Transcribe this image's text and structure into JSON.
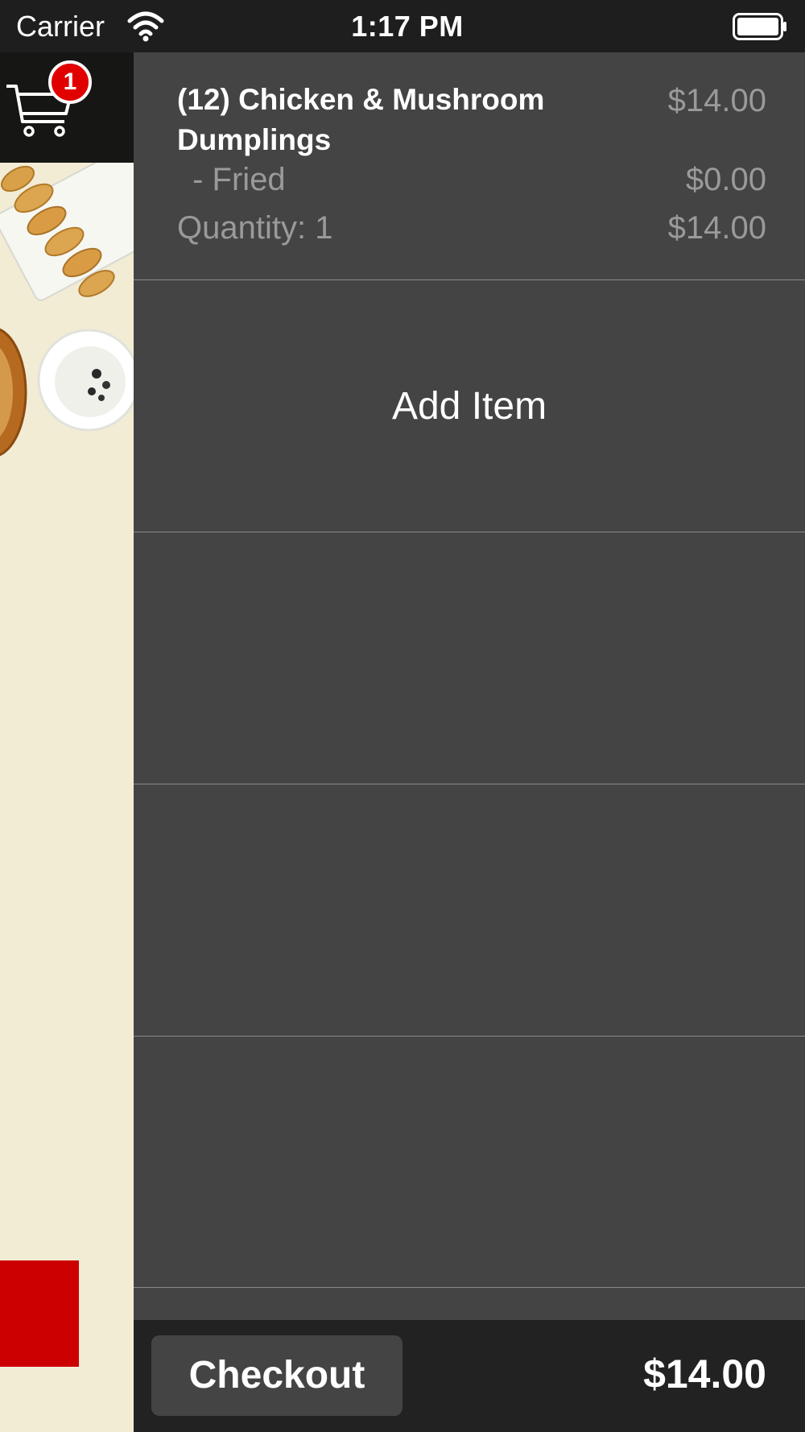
{
  "status_bar": {
    "carrier": "Carrier",
    "time": "1:17 PM"
  },
  "left_panel": {
    "cart_badge_count": "1"
  },
  "cart": {
    "items": [
      {
        "name": "(12) Chicken & Mushroom Dumplings",
        "price": "$14.00",
        "option": " - Fried",
        "option_price": "$0.00",
        "quantity_label": "Quantity: 1",
        "line_total": "$14.00"
      }
    ],
    "add_item_label": "Add Item"
  },
  "footer": {
    "checkout_label": "Checkout",
    "total": "$14.00"
  },
  "colors": {
    "accent_red": "#cc0000",
    "panel_bg": "#444444",
    "bar_bg": "#222222",
    "cream": "#f2ecd5"
  }
}
